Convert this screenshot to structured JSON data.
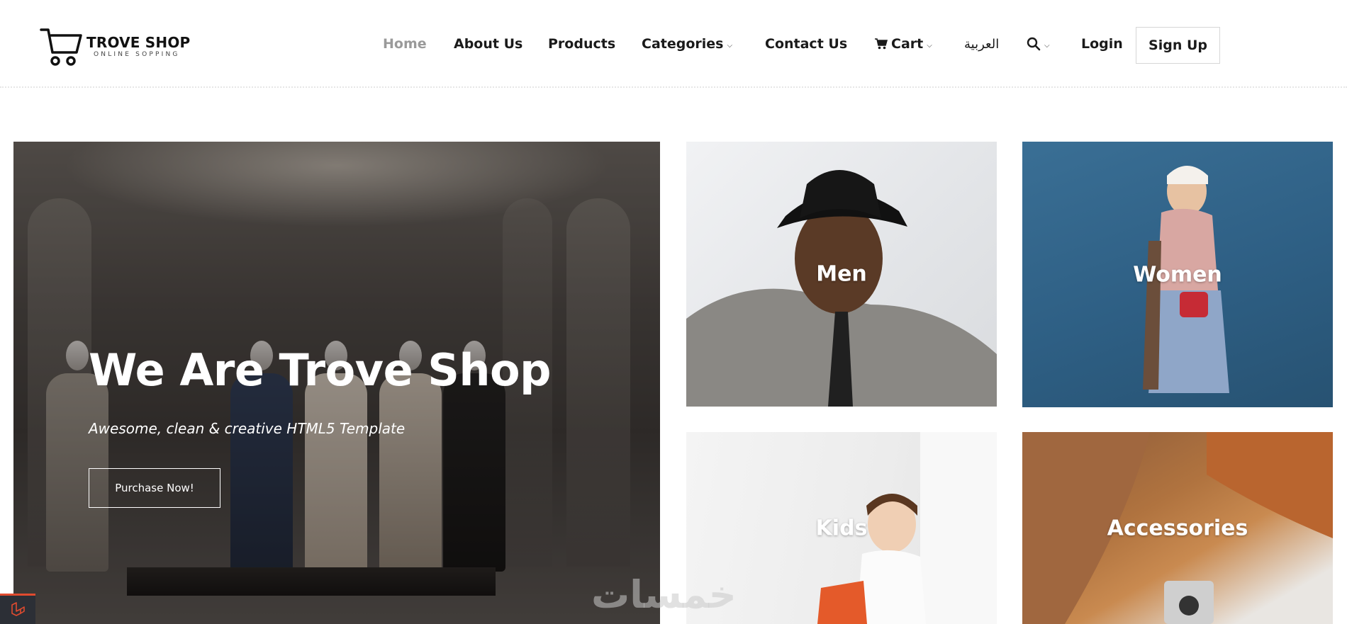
{
  "brand": {
    "name": "TROVE SHOP",
    "tagline": "ONLINE SOPPING"
  },
  "nav": {
    "items": [
      {
        "label": "Home",
        "active": true,
        "dropdown": false
      },
      {
        "label": "About Us",
        "dropdown": false
      },
      {
        "label": "Products",
        "dropdown": false
      },
      {
        "label": "Categories",
        "dropdown": true
      },
      {
        "label": "Contact Us",
        "dropdown": false
      },
      {
        "label": "Cart",
        "dropdown": true,
        "icon": "cart-icon"
      },
      {
        "label": "العربية",
        "dropdown": false
      },
      {
        "label": "",
        "dropdown": true,
        "icon": "search-icon"
      },
      {
        "label": "Login",
        "dropdown": false
      }
    ],
    "signup_label": "Sign Up"
  },
  "hero": {
    "title": "We Are Trove Shop",
    "subtitle": "Awesome, clean & creative HTML5 Template",
    "button_label": "Purchase Now!"
  },
  "categories": [
    {
      "label": "Men"
    },
    {
      "label": "Women"
    },
    {
      "label": "Kids"
    },
    {
      "label": "Accessories"
    }
  ],
  "watermark": "خمسات",
  "colors": {
    "nav_active": "#9a9a9a",
    "nav_text": "#1a1a1a",
    "women_bg": "#2e5f84",
    "badge_accent": "#e04b2f"
  }
}
